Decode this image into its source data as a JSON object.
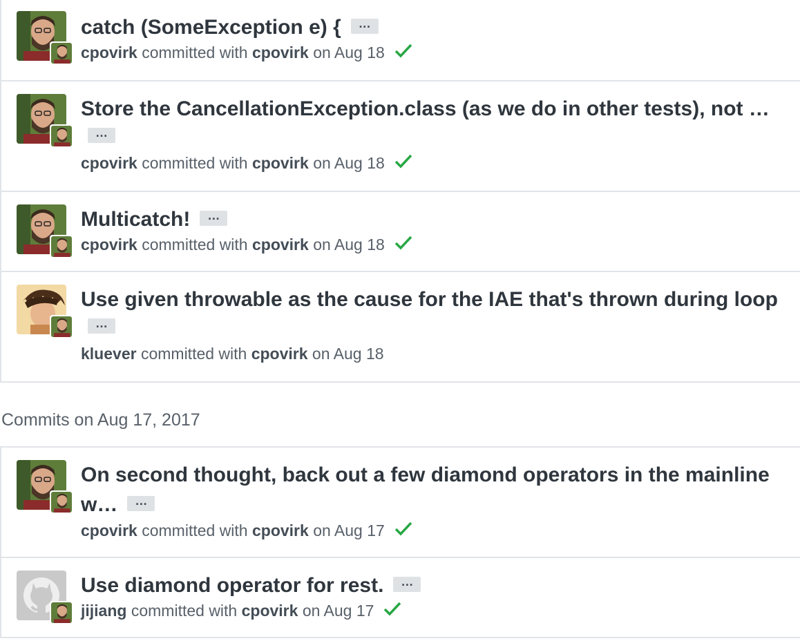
{
  "commit_groups": [
    {
      "heading": "",
      "commits": [
        {
          "title": "catch (SomeException e) {",
          "author": "cpovirk",
          "committer": "cpovirk",
          "date": "Aug 18",
          "verified": true,
          "avatar": "photo-avatar"
        },
        {
          "title": "Store the CancellationException.class (as we do in other tests), not …",
          "author": "cpovirk",
          "committer": "cpovirk",
          "date": "Aug 18",
          "verified": true,
          "avatar": "photo-avatar"
        },
        {
          "title": "Multicatch!",
          "author": "cpovirk",
          "committer": "cpovirk",
          "date": "Aug 18",
          "verified": true,
          "avatar": "photo-avatar"
        },
        {
          "title": "Use given throwable as the cause for the IAE that's thrown during loop",
          "author": "kluever",
          "committer": "cpovirk",
          "date": "Aug 18",
          "verified": false,
          "avatar": "hair-avatar"
        }
      ]
    },
    {
      "heading": "Commits on Aug 17, 2017",
      "commits": [
        {
          "title_line1": "On second thought, back out a few diamond operators in the mainline",
          "title_line2": "w…",
          "author": "cpovirk",
          "committer": "cpovirk",
          "date": "Aug 17",
          "verified": true,
          "avatar": "photo-avatar"
        },
        {
          "title": "Use diamond operator for rest.",
          "author": "jijiang",
          "committer": "cpovirk",
          "date": "Aug 17",
          "verified": true,
          "avatar": "octocat-avatar"
        }
      ]
    }
  ],
  "labels": {
    "committed_with": " committed with ",
    "on": " on ",
    "ellipsis": "…"
  },
  "colors": {
    "verified_check": "#28a745",
    "border": "#e1e4e8",
    "ellipsis_bg": "#dfe2e5"
  }
}
